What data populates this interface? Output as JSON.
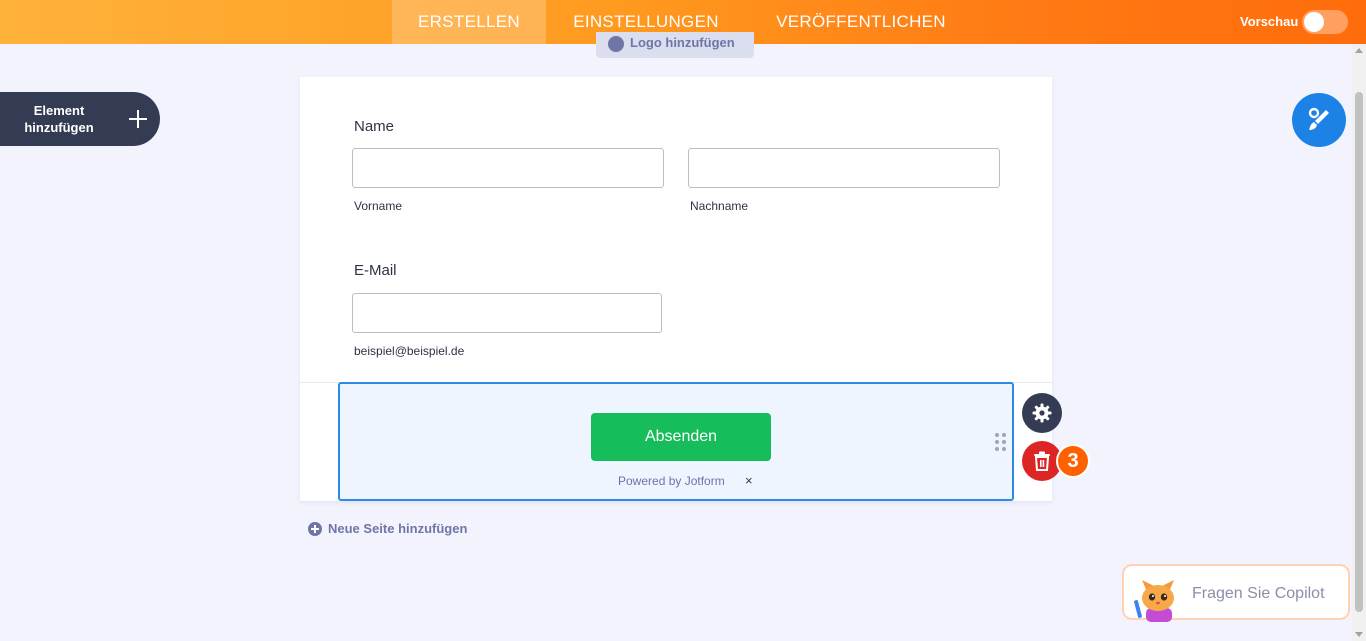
{
  "topbar": {
    "tabs": [
      {
        "label": "ERSTELLEN",
        "active": true
      },
      {
        "label": "EINSTELLUNGEN",
        "active": false
      },
      {
        "label": "VERÖFFENTLICHEN",
        "active": false
      }
    ],
    "preview_label": "Vorschau",
    "preview_on": false
  },
  "logo": {
    "label": "Logo hinzufügen"
  },
  "add_element": {
    "label": "Element hinzufügen"
  },
  "form": {
    "name_field": {
      "label": "Name",
      "first_value": "",
      "last_value": "",
      "first_sublabel": "Vorname",
      "last_sublabel": "Nachname"
    },
    "email_field": {
      "label": "E-Mail",
      "value": "",
      "sublabel": "beispiel@beispiel.de"
    },
    "submit": {
      "label": "Absenden",
      "powered_by": "Powered by Jotform",
      "close_glyph": "×"
    }
  },
  "actions": {
    "badge_count": "3"
  },
  "new_page": {
    "label": "Neue Seite hinzufügen"
  },
  "copilot": {
    "label": "Fragen Sie Copilot"
  },
  "colors": {
    "accent_orange": "#ff6100",
    "submit_green": "#18bd5b",
    "selection_blue": "#2b8ae6",
    "delete_red": "#dc2626",
    "dark_navy": "#343c54"
  },
  "icons": [
    "plus-icon",
    "paint-brush-icon",
    "gear-icon",
    "trash-icon",
    "drag-handle-icon",
    "close-icon",
    "copilot-cat-icon"
  ]
}
